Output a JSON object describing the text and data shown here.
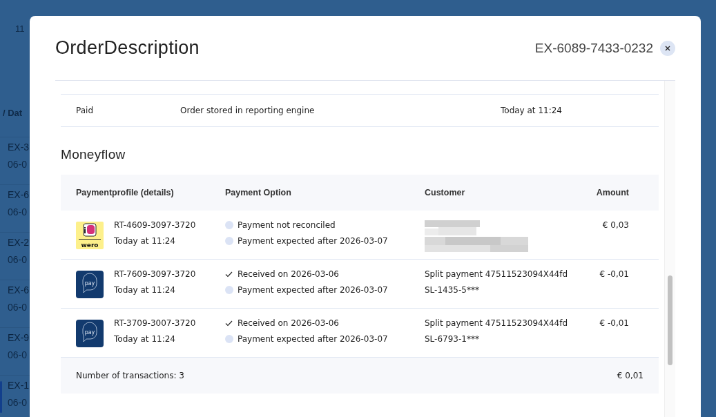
{
  "backdrop": {
    "axis_label": "11",
    "column_header": "/ Dat",
    "rows": [
      {
        "id": "EX-3",
        "date": "06-0",
        "selected": false
      },
      {
        "id": "EX-6",
        "date": "06-0",
        "selected": false
      },
      {
        "id": "EX-2",
        "date": "06-0",
        "selected": false
      },
      {
        "id": "EX-6",
        "date": "06-0",
        "selected": false
      },
      {
        "id": "EX-9",
        "date": "06-0",
        "selected": false
      },
      {
        "id": "EX-1",
        "date": "06-0",
        "selected": true
      }
    ]
  },
  "modal": {
    "title": "OrderDescription",
    "reference": "EX-6089-7433-0232"
  },
  "events": [
    {
      "status": "Paid",
      "description": "Order stored in reporting engine",
      "time": "Today at 11:24"
    }
  ],
  "moneyflow": {
    "title": "Moneyflow",
    "columns": [
      "Paymentprofile (details)",
      "Payment Option",
      "Customer",
      "Amount"
    ],
    "rows": [
      {
        "logo": {
          "kind": "wero",
          "text": "wero"
        },
        "profile": "RT-4609-3097-3720",
        "time": "Today at 11:24",
        "options": [
          {
            "kind": "pending",
            "text": "Payment not reconciled"
          },
          {
            "kind": "pending",
            "text": "Payment expected after 2026-03-07"
          }
        ],
        "customer_redacted": true,
        "amount": "€ 0,03"
      },
      {
        "logo": {
          "kind": "pay",
          "text": "pay"
        },
        "profile": "RT-7609-3097-3720",
        "time": "Today at 11:24",
        "options": [
          {
            "kind": "received",
            "text": "Received on 2026-03-06"
          },
          {
            "kind": "pending",
            "text": "Payment expected after 2026-03-07"
          }
        ],
        "customer_redacted": false,
        "customer": [
          "Split payment 47511523094X44fd",
          "SL-1435-5***"
        ],
        "amount": "€ -0,01"
      },
      {
        "logo": {
          "kind": "pay",
          "text": "pay"
        },
        "profile": "RT-3709-3007-3720",
        "time": "Today at 11:24",
        "options": [
          {
            "kind": "received",
            "text": "Received on 2026-03-06"
          },
          {
            "kind": "pending",
            "text": "Payment expected after 2026-03-07"
          }
        ],
        "customer_redacted": false,
        "customer": [
          "Split payment 47511523094X44fd",
          "SL-6793-1***"
        ],
        "amount": "€ -0,01"
      }
    ],
    "footer": {
      "count": "Number of transactions: 3",
      "total": "€ 0,01"
    }
  }
}
